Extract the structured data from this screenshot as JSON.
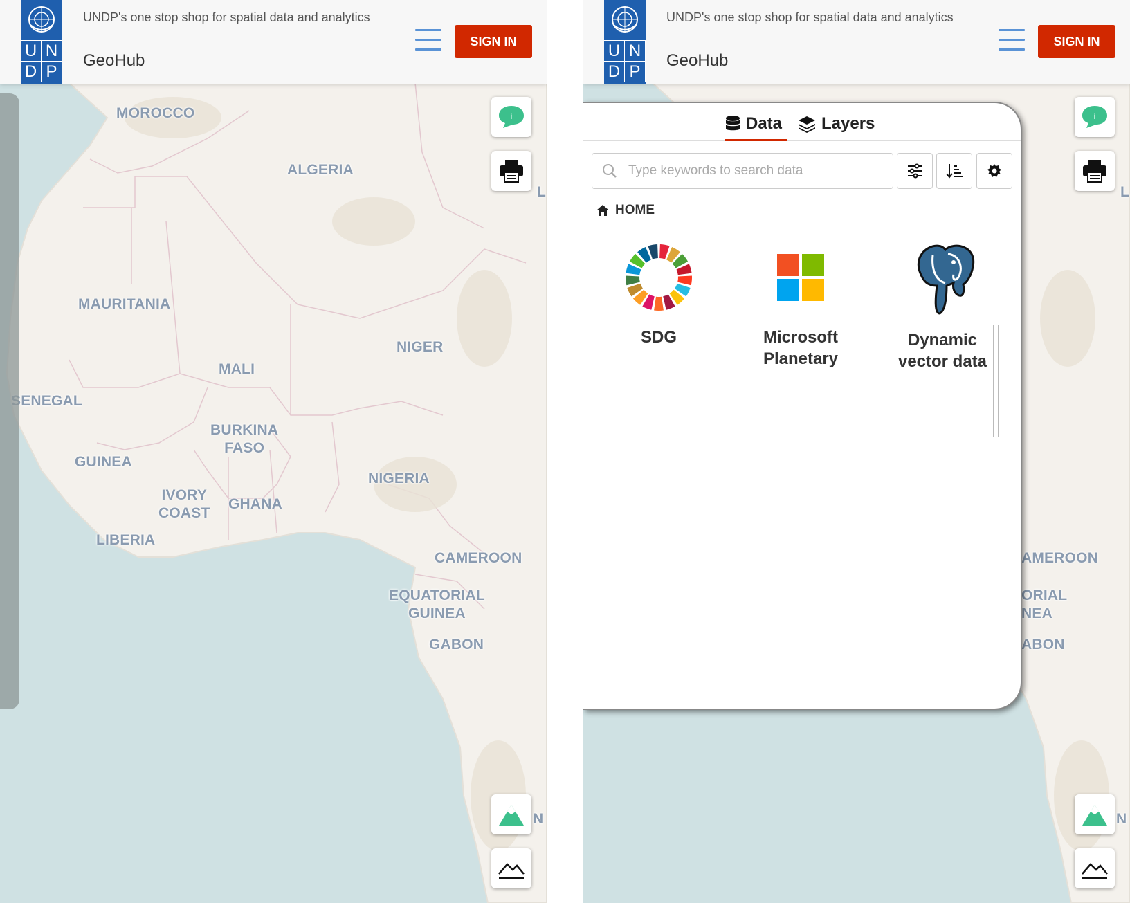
{
  "header": {
    "tagline": "UNDP's one stop shop for spatial data and analytics",
    "site_name": "GeoHub",
    "logo_letters": [
      "U",
      "N",
      "D",
      "P"
    ],
    "sign_in_label": "SIGN IN"
  },
  "map": {
    "labels": {
      "morocco": "MOROCCO",
      "algeria": "ALGERIA",
      "mauritania": "MAURITANIA",
      "mali": "MALI",
      "niger": "NIGER",
      "senegal": "SENEGAL",
      "burkina_faso": "BURKINA\nFASO",
      "guinea": "GUINEA",
      "nigeria": "NIGERIA",
      "ivory_coast": "IVORY\nCOAST",
      "ghana": "GHANA",
      "liberia": "LIBERIA",
      "cameroon": "CAMEROON",
      "equatorial_guinea": "EQUATORIAL\nGUINEA",
      "gabon": "GABON"
    },
    "right_labels": {
      "cameroon": "AMEROON",
      "equatorial_guinea": "ORIAL\nNEA",
      "gabon": "ABON"
    },
    "edge_letters": {
      "top": "L",
      "bottom": "N"
    }
  },
  "panel": {
    "tabs": {
      "data": "Data",
      "layers": "Layers"
    },
    "search": {
      "placeholder": "Type keywords to search data",
      "value": ""
    },
    "breadcrumb": "HOME",
    "items": {
      "sdg": "SDG",
      "microsoft": "Microsoft\nPlanetary",
      "dynamic": "Dynamic\nvector data"
    }
  },
  "colors": {
    "brand_blue": "#1f5fae",
    "sign_in_red": "#d12800",
    "accent_green": "#3cc08c",
    "water": "#cfe1e3",
    "land": "#f4f1ec"
  }
}
